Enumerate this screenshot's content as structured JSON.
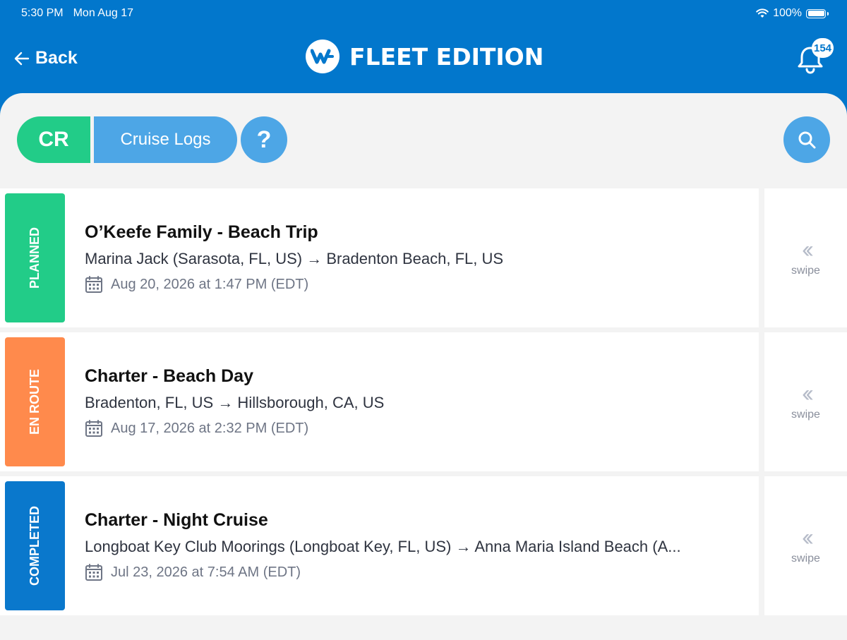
{
  "status_bar": {
    "time": "5:30 PM",
    "date": "Mon Aug 17",
    "battery": "100%",
    "battery_level": 1.0
  },
  "header": {
    "back_label": "Back",
    "brand": "FLEET EDITION",
    "notification_count": "154"
  },
  "toolbar": {
    "code": "CR",
    "section_label": "Cruise Logs",
    "help_label": "?"
  },
  "colors": {
    "header": "#0277cc",
    "planned": "#22cc88",
    "en_route": "#ff8a4c",
    "completed": "#0a78cc",
    "pill": "#4da6e6"
  },
  "logs": [
    {
      "status": "PLANNED",
      "title": "O’Keefe Family - Beach Trip",
      "route": "Marina Jack (Sarasota, FL, US) → Bradenton Beach, FL, US",
      "date": "Aug 20, 2026 at 1:47 PM (EDT)",
      "swipe": "swipe"
    },
    {
      "status": "EN ROUTE",
      "title": "Charter - Beach Day",
      "route": "Bradenton, FL, US → Hillsborough, CA, US",
      "date": "Aug 17, 2026 at 2:32 PM (EDT)",
      "swipe": "swipe"
    },
    {
      "status": "COMPLETED",
      "title": "Charter - Night Cruise",
      "route": "Longboat Key Club Moorings (Longboat Key, FL, US) → Anna Maria Island Beach (A...",
      "date": "Jul 23, 2026 at 7:54 AM (EDT)",
      "swipe": "swipe"
    }
  ]
}
